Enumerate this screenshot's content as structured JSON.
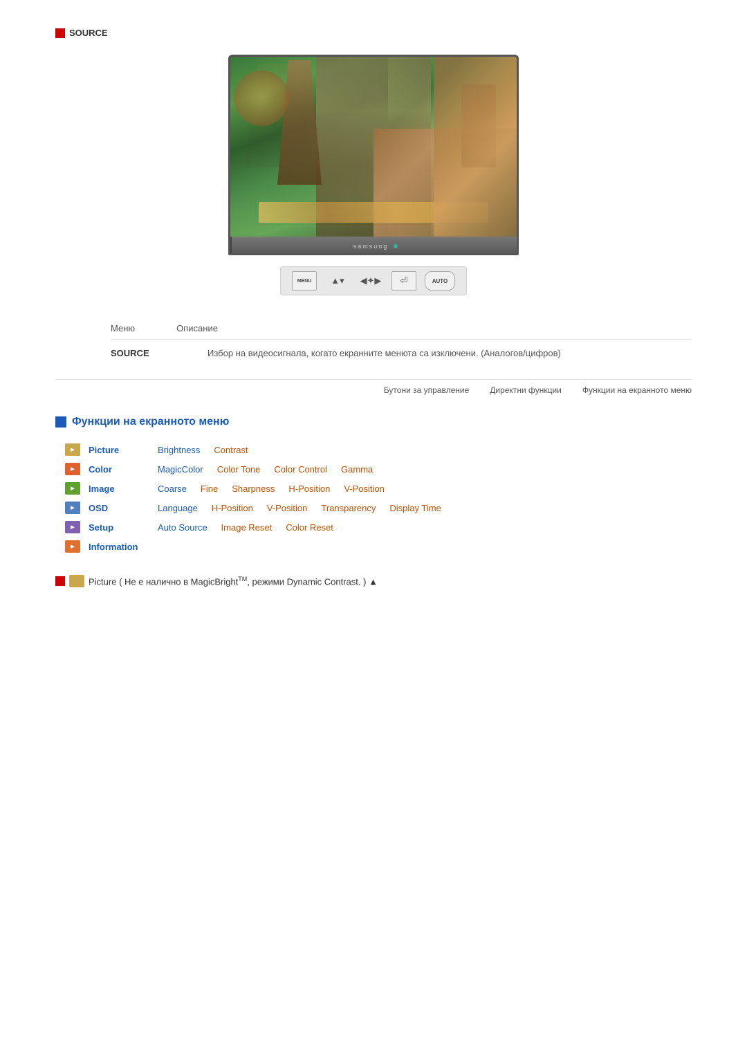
{
  "source_header": {
    "icon": "source-icon",
    "label": "SOURCE"
  },
  "monitor": {
    "brand": "samsung",
    "led_color": "#44aa99"
  },
  "controls": [
    {
      "id": "menu-btn",
      "label": "MENU",
      "type": "menu"
    },
    {
      "id": "brightness-btn",
      "label": "▲▼",
      "type": "arrow"
    },
    {
      "id": "adjust-btn",
      "label": "◀▶✦",
      "type": "adjust"
    },
    {
      "id": "enter-btn",
      "label": "⏎",
      "type": "enter"
    },
    {
      "id": "auto-btn",
      "label": "AUTO",
      "type": "auto"
    }
  ],
  "table": {
    "header": {
      "col1": "Меню",
      "col2": "Описание"
    },
    "row": {
      "menu": "SOURCE",
      "desc": "Избор на видеосигнала, когато екранните менюта са изключени. (Аналогов/цифров)"
    }
  },
  "nav_tabs": [
    {
      "id": "control-buttons",
      "label": "Бутони за управление"
    },
    {
      "id": "direct-functions",
      "label": "Директни функции"
    },
    {
      "id": "osd-functions",
      "label": "Функции на екранното меню"
    }
  ],
  "osd_section": {
    "title": "Функции на екранното меню",
    "menu_items": [
      {
        "id": "picture",
        "icon_class": "icon-picture",
        "name": "Picture",
        "subitems": [
          {
            "label": "Brightness",
            "style": "blue"
          },
          {
            "label": "Contrast",
            "style": "orange"
          }
        ]
      },
      {
        "id": "color",
        "icon_class": "icon-color",
        "name": "Color",
        "subitems": [
          {
            "label": "MagicColor",
            "style": "blue"
          },
          {
            "label": "Color Tone",
            "style": "orange"
          },
          {
            "label": "Color Control",
            "style": "orange"
          },
          {
            "label": "Gamma",
            "style": "orange"
          }
        ]
      },
      {
        "id": "image",
        "icon_class": "icon-image",
        "name": "Image",
        "subitems": [
          {
            "label": "Coarse",
            "style": "blue"
          },
          {
            "label": "Fine",
            "style": "orange"
          },
          {
            "label": "Sharpness",
            "style": "orange"
          },
          {
            "label": "H-Position",
            "style": "orange"
          },
          {
            "label": "V-Position",
            "style": "orange"
          }
        ]
      },
      {
        "id": "osd",
        "icon_class": "icon-osd",
        "name": "OSD",
        "subitems": [
          {
            "label": "Language",
            "style": "blue"
          },
          {
            "label": "H-Position",
            "style": "orange"
          },
          {
            "label": "V-Position",
            "style": "orange"
          },
          {
            "label": "Transparency",
            "style": "orange"
          },
          {
            "label": "Display Time",
            "style": "orange"
          }
        ]
      },
      {
        "id": "setup",
        "icon_class": "icon-setup",
        "name": "Setup",
        "subitems": [
          {
            "label": "Auto Source",
            "style": "blue"
          },
          {
            "label": "Image Reset",
            "style": "orange"
          },
          {
            "label": "Color Reset",
            "style": "orange"
          }
        ]
      },
      {
        "id": "information",
        "icon_class": "icon-info",
        "name": "Information",
        "subitems": []
      }
    ]
  },
  "footer": {
    "text": "Picture ( Не е налично в MagicBright",
    "superscript": "TM",
    "text2": ", режими Dynamic Contrast. )"
  }
}
